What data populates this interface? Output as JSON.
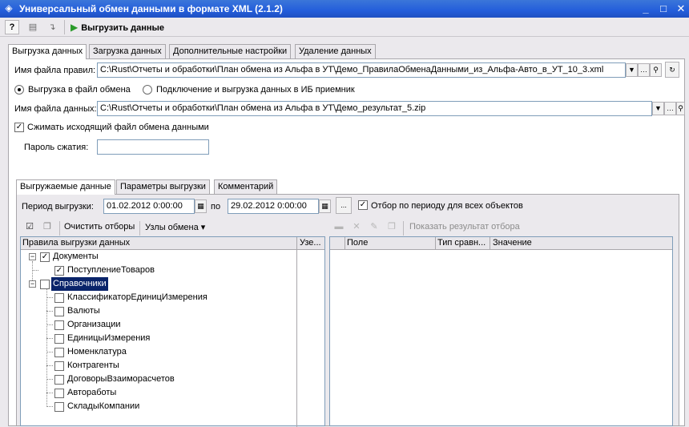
{
  "window": {
    "title": "Универсальный обмен данными в формате XML (2.1.2)",
    "controls": [
      "_",
      "□",
      "✕"
    ]
  },
  "toolbar": {
    "help_label": "?",
    "run_label": "Выгрузить данные"
  },
  "main_tabs": [
    "Выгрузка данных",
    "Загрузка данных",
    "Дополнительные настройки",
    "Удаление данных"
  ],
  "rules": {
    "label": "Имя файла правил:",
    "value": "C:\\Rust\\Отчеты и обработки\\План обмена из Альфа в УТ\\Демо_ПравилаОбменаДанными_из_Альфа-Авто_в_УТ_10_3.xml"
  },
  "mode": {
    "option_file": "Выгрузка в файл обмена",
    "option_ib": "Подключение и выгрузка данных в ИБ приемник",
    "selected": "file"
  },
  "datafile": {
    "label": "Имя файла данных:",
    "value": "C:\\Rust\\Отчеты и обработки\\План обмена из Альфа в УТ\\Демо_результат_5.zip"
  },
  "compress": {
    "label": "Сжимать исходящий файл обмена данными",
    "checked": true
  },
  "password": {
    "label": "Пароль сжатия:",
    "value": ""
  },
  "sub_tabs": [
    "Выгружаемые данные",
    "Параметры выгрузки",
    "Комментарий"
  ],
  "period": {
    "label": "Период выгрузки:",
    "from": "01.02.2012 0:00:00",
    "to_label": "по",
    "to": "29.02.2012 0:00:00",
    "ellipsis": "...",
    "filter_label": "Отбор по периоду для всех объектов",
    "filter_checked": true
  },
  "rules_toolbar": {
    "clear_label": "Очистить отборы",
    "nodes_label": "Узлы обмена",
    "show_result_label": "Показать результат отбора"
  },
  "tree": {
    "col_rules": "Правила выгрузки данных",
    "col_node": "Узе...",
    "groups": [
      {
        "name": "Документы",
        "checked": true,
        "expanded": true,
        "items": [
          {
            "name": "ПоступлениеТоваров",
            "checked": true
          }
        ]
      },
      {
        "name": "Справочники",
        "checked": false,
        "expanded": true,
        "selected": true,
        "items": [
          {
            "name": "КлассификаторЕдиницИзмерения",
            "checked": false
          },
          {
            "name": "Валюты",
            "checked": false
          },
          {
            "name": "Организации",
            "checked": false
          },
          {
            "name": "ЕдиницыИзмерения",
            "checked": false
          },
          {
            "name": "Номенклатура",
            "checked": false
          },
          {
            "name": "Контрагенты",
            "checked": false
          },
          {
            "name": "ДоговорыВзаиморасчетов",
            "checked": false
          },
          {
            "name": "Автоработы",
            "checked": false
          },
          {
            "name": "СкладыКомпании",
            "checked": false
          }
        ]
      }
    ]
  },
  "filter_table": {
    "columns": [
      "Поле",
      "Тип сравн...",
      "Значение"
    ]
  }
}
